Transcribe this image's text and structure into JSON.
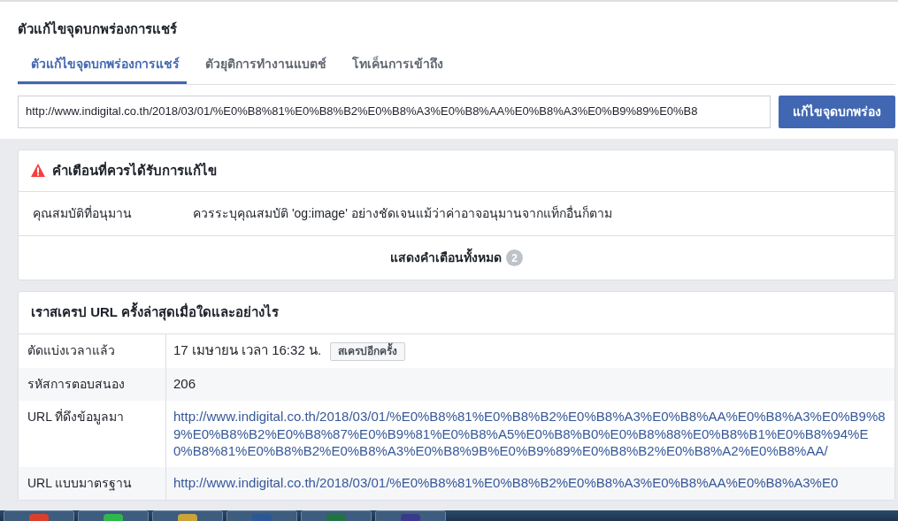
{
  "header": {
    "title": "ตัวแก้ไขจุดบกพร่องการแชร์"
  },
  "tabs": [
    {
      "label": "ตัวแก้ไขจุดบกพร่องการแชร์",
      "selected": true
    },
    {
      "label": "ตัวยุติการทำงานแบตช์",
      "selected": false
    },
    {
      "label": "โทเค็นการเข้าถึง",
      "selected": false
    }
  ],
  "url_field": {
    "value": "http://www.indigital.co.th/2018/03/01/%E0%B8%81%E0%B8%B2%E0%B8%A3%E0%B8%AA%E0%B8%A3%E0%B9%89%E0%B8"
  },
  "debug_button": "แก้ไขจุดบกพร่อง",
  "warnings": {
    "title": "คำเตือนที่ควรได้รับการแก้ไข",
    "rows": [
      {
        "label": "คุณสมบัติที่อนุมาน",
        "message": "ควรระบุคุณสมบัติ 'og:image' อย่างชัดเจนแม้ว่าค่าอาจอนุมานจากแท็กอื่นก็ตาม"
      }
    ],
    "show_all": "แสดงคำเตือนทั้งหมด",
    "count": "2"
  },
  "scrape": {
    "title": "เราสเครป URL ครั้งล่าสุดเมื่อใดและอย่างไร",
    "rows": [
      {
        "label": "ตัดแบ่งเวลาแล้ว",
        "value": "17 เมษายน เวลา 16:32 น.",
        "kind": "time",
        "button": "สเครปอีกครั้ง"
      },
      {
        "label": "รหัสการตอบสนอง",
        "value": "206",
        "kind": "text"
      },
      {
        "label": "URL ที่ดึงข้อมูลมา",
        "value": "http://www.indigital.co.th/2018/03/01/%E0%B8%81%E0%B8%B2%E0%B8%A3%E0%B8%AA%E0%B8%A3%E0%B9%89%E0%B8%B2%E0%B8%87%E0%B9%81%E0%B8%A5%E0%B8%B0%E0%B8%88%E0%B8%B1%E0%B8%94%E0%B8%81%E0%B8%B2%E0%B8%A3%E0%B8%9B%E0%B9%89%E0%B8%B2%E0%B8%A2%E0%B8%AA/",
        "kind": "link"
      },
      {
        "label": "URL แบบมาตรฐาน",
        "value": "http://www.indigital.co.th/2018/03/01/%E0%B8%81%E0%B8%B2%E0%B8%A3%E0%B8%AA%E0%B8%A3%E0",
        "kind": "link"
      }
    ]
  }
}
